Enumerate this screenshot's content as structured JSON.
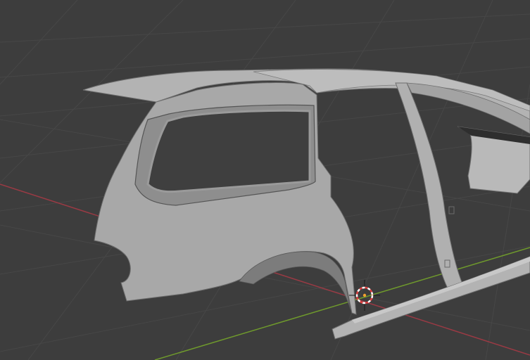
{
  "viewport": {
    "kind": "3d-viewport",
    "background_color": "#3d3d3d",
    "grid_line_color": "#4a4a4a",
    "x_axis_color": "#9a3a44",
    "y_axis_color": "#6f9a2c",
    "show_grid": true
  },
  "object": {
    "name_visible": "",
    "shape": "car-body-shell",
    "body_color": "#a9a9a9",
    "shadow_color": "#7f7f7f",
    "highlight_color": "#c4c4c4",
    "outline_color": "#4a4a4a"
  },
  "cursor": {
    "icon": "3d-cursor-icon",
    "ring_color_a": "#e04040",
    "ring_color_b": "#ffffff",
    "center_color": "#f2a030"
  }
}
